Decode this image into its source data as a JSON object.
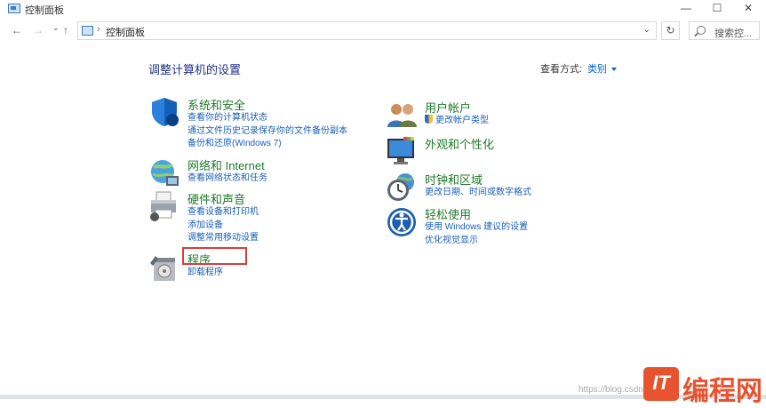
{
  "window": {
    "title": "控制面板",
    "min_glyph": "—",
    "max_glyph": "☐",
    "close_glyph": "✕"
  },
  "nav": {
    "back_glyph": "←",
    "forward_glyph": "→",
    "recent_glyph": "⌄",
    "up_glyph": "↑",
    "breadcrumb_sep": "›",
    "breadcrumb": "控制面板",
    "dropdown_glyph": "⌄",
    "refresh_glyph": "↻",
    "search_placeholder": "搜索控..."
  },
  "main": {
    "heading": "调整计算机的设置",
    "view_by_label": "查看方式:",
    "view_by_value": "类别",
    "left": [
      {
        "title": "系统和安全",
        "icon": "shield-icon",
        "links": [
          "查看你的计算机状态",
          "通过文件历史记录保存你的文件备份副本",
          "备份和还原(Windows 7)"
        ]
      },
      {
        "title": "网络和 Internet",
        "icon": "network-globe-icon",
        "links": [
          "查看网络状态和任务"
        ]
      },
      {
        "title": "硬件和声音",
        "icon": "printer-icon",
        "links": [
          "查看设备和打印机",
          "添加设备",
          "调整常用移动设置"
        ]
      },
      {
        "title": "程序",
        "icon": "programs-box-icon",
        "links": [
          "卸载程序"
        ]
      }
    ],
    "right": [
      {
        "title": "用户帐户",
        "icon": "users-icon",
        "links": [
          "更改帐户类型"
        ]
      },
      {
        "title": "外观和个性化",
        "icon": "monitor-icon",
        "links": []
      },
      {
        "title": "时钟和区域",
        "icon": "clock-globe-icon",
        "links": [
          "更改日期、时间或数字格式"
        ]
      },
      {
        "title": "轻松使用",
        "icon": "accessibility-icon",
        "links": [
          "使用 Windows 建议的设置",
          "优化视觉显示"
        ]
      }
    ]
  },
  "watermark": {
    "url_text": "https://blog.csdn.",
    "logo_mark": "IT",
    "brand": "编程网"
  }
}
